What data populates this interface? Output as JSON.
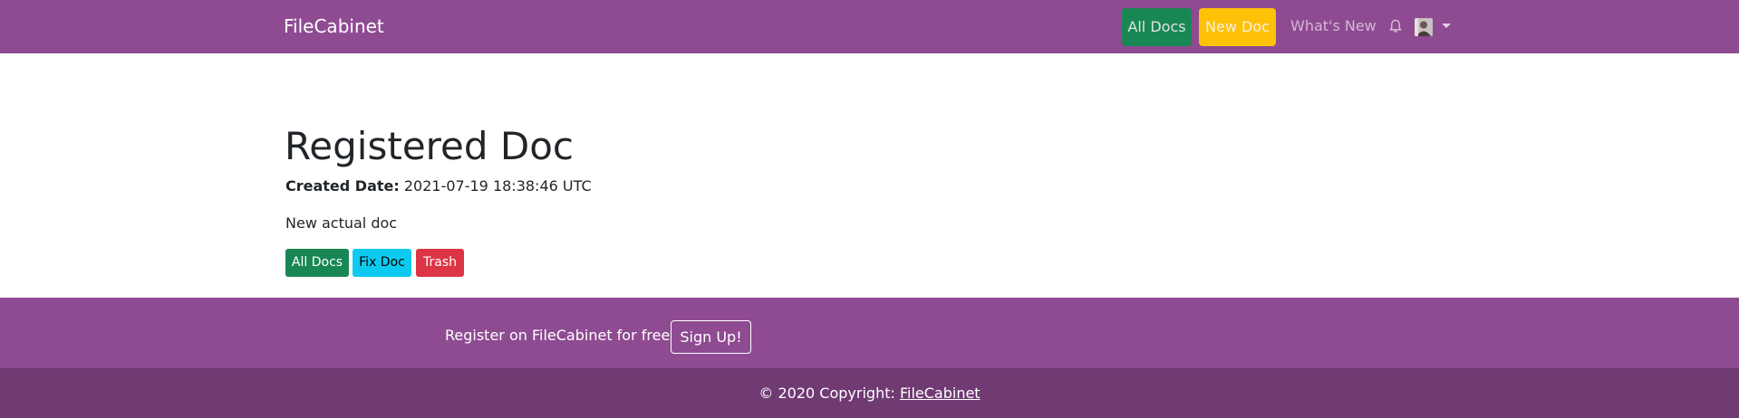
{
  "navbar": {
    "brand": "FileCabinet",
    "all_docs_label": "All Docs",
    "new_doc_label": "New Doc",
    "whats_new_label": "What's New",
    "bell_icon": "bell-icon",
    "avatar_icon": "user-avatar",
    "caret_icon": "chevron-down-icon",
    "colors": {
      "background": "#8e4b92"
    }
  },
  "doc": {
    "title": "Registered Doc",
    "created_label": "Created Date:",
    "created_value": "2021-07-19 18:38:46 UTC",
    "description": "New actual doc"
  },
  "actions": {
    "all_docs_label": "All Docs",
    "fix_doc_label": "Fix Doc",
    "trash_label": "Trash",
    "colors": {
      "all_docs": "#198754",
      "fix_doc": "#0dcaf0",
      "trash": "#dc3545"
    }
  },
  "footer": {
    "register_text": "Register on FileCabinet for free",
    "signup_label": "Sign Up!",
    "copyright_prefix": "© 2020 Copyright:",
    "copyright_link": "FileCabinet",
    "colors": {
      "top": "#8e4b92",
      "bottom": "#703a73"
    }
  }
}
